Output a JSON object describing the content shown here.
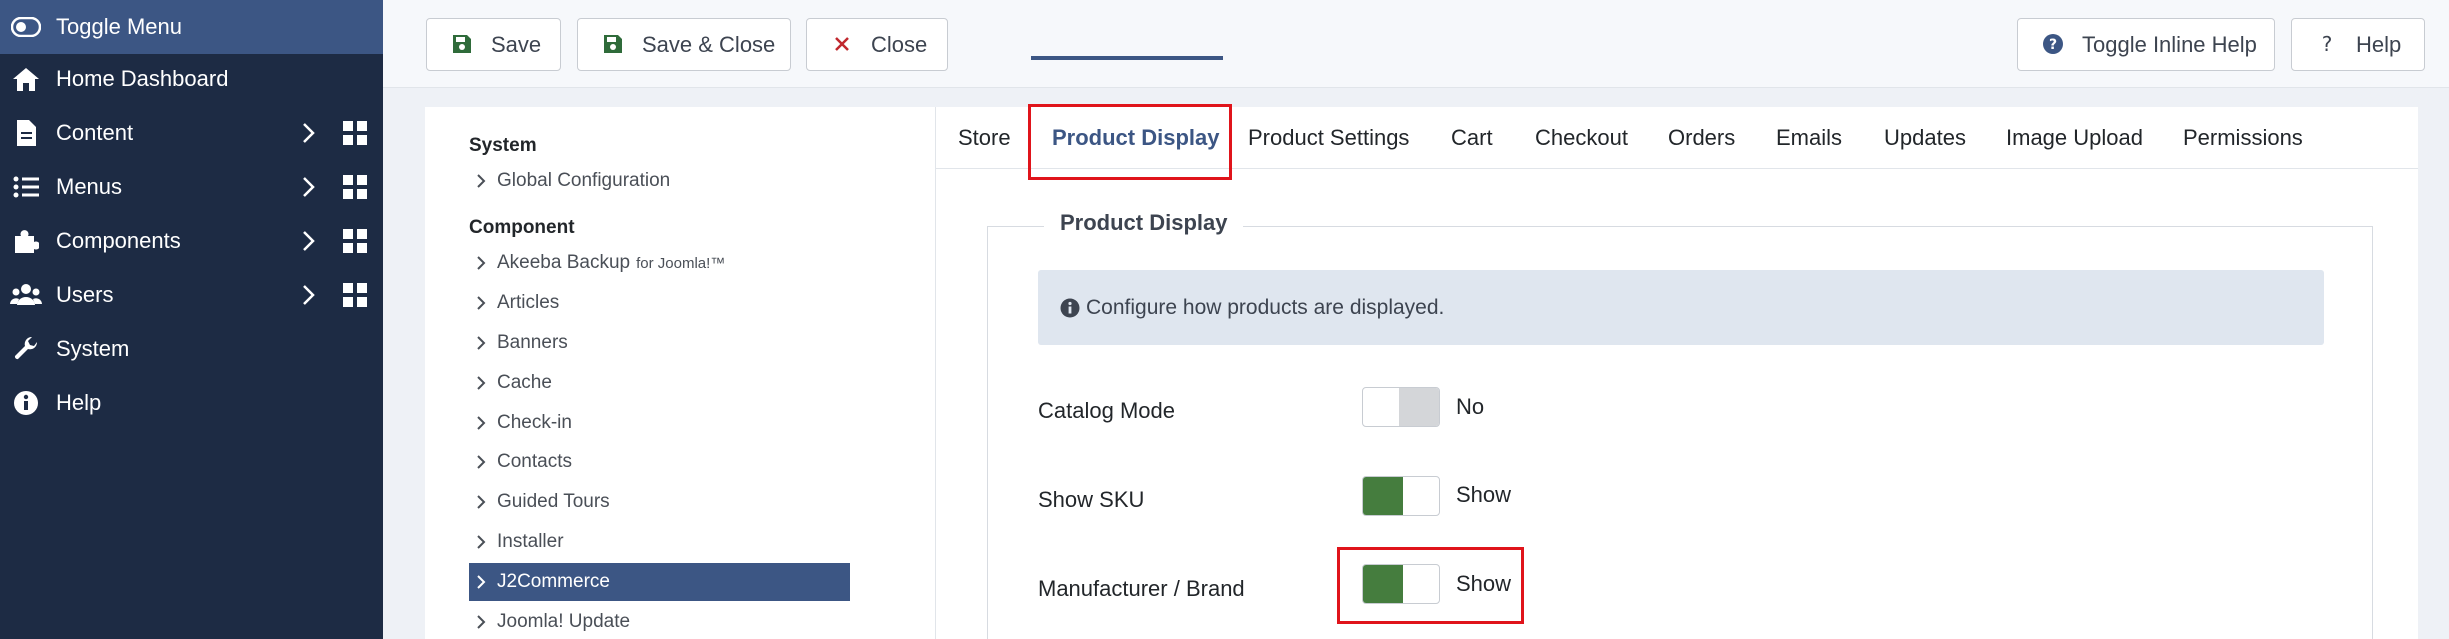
{
  "sidebar": {
    "toggle_menu": "Toggle Menu",
    "items": [
      {
        "label": "Home Dashboard",
        "icon": "home-icon"
      },
      {
        "label": "Content",
        "icon": "file-icon"
      },
      {
        "label": "Menus",
        "icon": "list-icon"
      },
      {
        "label": "Components",
        "icon": "puzzle-icon"
      },
      {
        "label": "Users",
        "icon": "users-icon"
      },
      {
        "label": "System",
        "icon": "wrench-icon"
      },
      {
        "label": "Help",
        "icon": "info-icon"
      }
    ]
  },
  "toolbar": {
    "save": "Save",
    "save_close": "Save & Close",
    "close": "Close",
    "toggle_inline_help": "Toggle Inline Help",
    "help": "Help"
  },
  "leftnav": {
    "system_heading": "System",
    "global_configuration": "Global Configuration",
    "component_heading": "Component",
    "akeeba": "Akeeba Backup",
    "akeeba_suffix": "for Joomla!™",
    "items": [
      "Articles",
      "Banners",
      "Cache",
      "Check-in",
      "Contacts",
      "Guided Tours",
      "Installer",
      "J2Commerce",
      "Joomla! Update"
    ]
  },
  "tabs": [
    "Store",
    "Product Display",
    "Product Settings",
    "Cart",
    "Checkout",
    "Orders",
    "Emails",
    "Updates",
    "Image Upload",
    "Permissions"
  ],
  "panel": {
    "legend": "Product Display",
    "info": "Configure how products are displayed.",
    "fields": [
      {
        "label": "Catalog Mode",
        "value": "No",
        "state": "off"
      },
      {
        "label": "Show SKU",
        "value": "Show",
        "state": "on"
      },
      {
        "label": "Manufacturer / Brand",
        "value": "Show",
        "state": "on"
      }
    ]
  },
  "colors": {
    "sidebar_bg": "#1d2b44",
    "accent": "#3c5684",
    "switch_on": "#457d3e",
    "highlight": "#e0141b"
  }
}
